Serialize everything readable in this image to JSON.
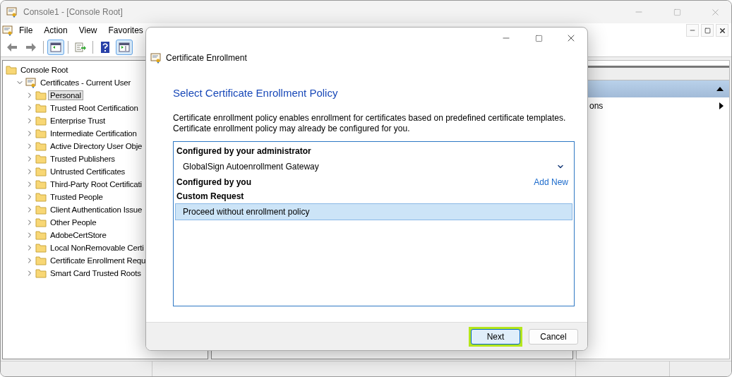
{
  "window": {
    "title": "Console1 - [Console Root]"
  },
  "menu": [
    {
      "label": "File"
    },
    {
      "label": "Action"
    },
    {
      "label": "View"
    },
    {
      "label": "Favorites"
    }
  ],
  "toolbar": [
    {
      "kind": "back",
      "pressed": false
    },
    {
      "kind": "forward",
      "pressed": false
    },
    {
      "kind": "tree-toggle",
      "pressed": true
    },
    {
      "kind": "export",
      "pressed": false
    },
    {
      "kind": "help",
      "pressed": false
    },
    {
      "kind": "pane-toggle",
      "pressed": true
    }
  ],
  "tree": [
    {
      "label": "Console Root",
      "kind": "folder",
      "selected": false,
      "children": [
        {
          "label": "Certificates - Current User",
          "kind": "certificate",
          "selected": false,
          "expanded": true,
          "children": [
            {
              "label": "Personal",
              "kind": "folder",
              "selected": true,
              "expanded": false
            },
            {
              "label": "Trusted Root Certification",
              "kind": "folder",
              "selected": false,
              "expanded": false
            },
            {
              "label": "Enterprise Trust",
              "kind": "folder",
              "selected": false,
              "expanded": false
            },
            {
              "label": "Intermediate Certification",
              "kind": "folder",
              "selected": false,
              "expanded": false
            },
            {
              "label": "Active Directory User Obje",
              "kind": "folder",
              "selected": false,
              "expanded": false
            },
            {
              "label": "Trusted Publishers",
              "kind": "folder",
              "selected": false,
              "expanded": false
            },
            {
              "label": "Untrusted Certificates",
              "kind": "folder",
              "selected": false,
              "expanded": false
            },
            {
              "label": "Third-Party Root Certificati",
              "kind": "folder",
              "selected": false,
              "expanded": false
            },
            {
              "label": "Trusted People",
              "kind": "folder",
              "selected": false,
              "expanded": false
            },
            {
              "label": "Client Authentication Issue",
              "kind": "folder",
              "selected": false,
              "expanded": false
            },
            {
              "label": "Other People",
              "kind": "folder",
              "selected": false,
              "expanded": false
            },
            {
              "label": "AdobeCertStore",
              "kind": "folder",
              "selected": false,
              "expanded": false
            },
            {
              "label": "Local NonRemovable Certi",
              "kind": "folder",
              "selected": false,
              "expanded": false
            },
            {
              "label": "Certificate Enrollment Requ",
              "kind": "folder",
              "selected": false,
              "expanded": false
            },
            {
              "label": "Smart Card Trusted Roots",
              "kind": "folder",
              "selected": false,
              "expanded": false
            }
          ]
        }
      ]
    }
  ],
  "actions": {
    "header": {
      "expanded": true
    },
    "items": [
      {
        "label": "ons",
        "submenu": true
      }
    ]
  },
  "dialog": {
    "title": "Certificate Enrollment",
    "heading": "Select Certificate Enrollment Policy",
    "description": [
      "Certificate enrollment policy enables enrollment for certificates based on predefined certificate templates.",
      "Certificate enrollment policy may already be configured for you."
    ],
    "policies": [
      {
        "kind": "heading",
        "text": "Configured by your administrator"
      },
      {
        "kind": "policy",
        "label": "GlobalSign Autoenrollment Gateway",
        "selected": false,
        "expandable": true
      },
      {
        "kind": "heading",
        "text": "Configured by you",
        "link": "Add New"
      },
      {
        "kind": "heading",
        "text": "Custom Request"
      },
      {
        "kind": "policy",
        "label": "Proceed without enrollment policy",
        "selected": true,
        "expandable": false
      }
    ],
    "buttons": [
      {
        "label": "Next",
        "default": true,
        "highlighted": true
      },
      {
        "label": "Cancel",
        "default": false,
        "highlighted": false
      }
    ]
  }
}
